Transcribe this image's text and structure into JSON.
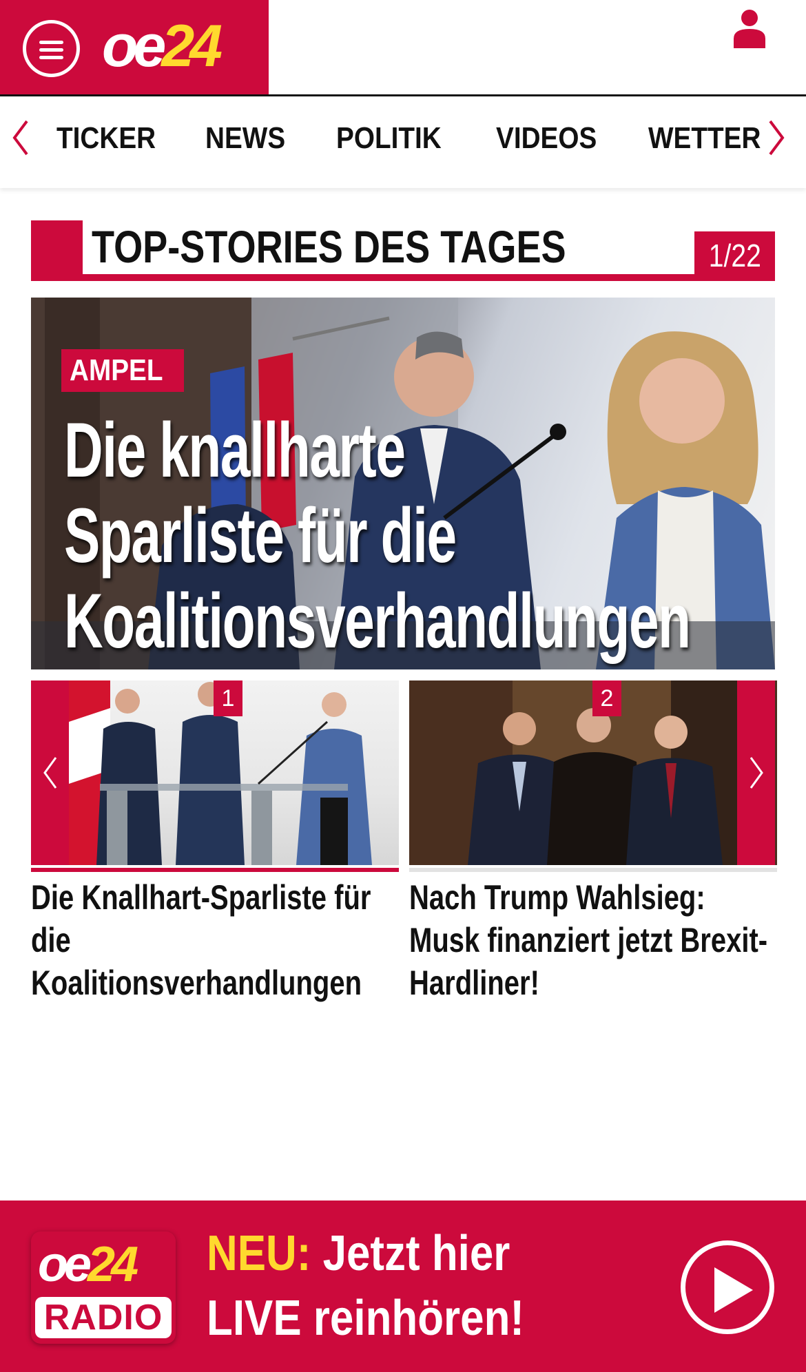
{
  "header": {
    "logo_oe": "oe",
    "logo_num": "24"
  },
  "nav": {
    "items": [
      {
        "label": "TICKER"
      },
      {
        "label": "NEWS"
      },
      {
        "label": "POLITIK"
      },
      {
        "label": "VIDEOS"
      },
      {
        "label": "WETTER"
      }
    ]
  },
  "section": {
    "title": "TOP-STORIES DES TAGES",
    "counter": "1/22"
  },
  "hero": {
    "tag": "AMPEL",
    "headline": "Die knallharte\nSparliste für die\nKoalitionsverhandlungen"
  },
  "stories": [
    {
      "badge": "1",
      "title": "Die Knallhart-Sparliste für die Koalitionsverhandlungen"
    },
    {
      "badge": "2",
      "title": "Nach Trump Wahlsieg: Musk finanziert jetzt Brexit-Hardliner!"
    }
  ],
  "radio": {
    "logo_oe": "oe",
    "logo_num": "24",
    "logo_radio": "RADIO",
    "neu": "NEU:",
    "line1_rest": " Jetzt hier",
    "line2": "LIVE reinhören!"
  },
  "colors": {
    "brand_red": "#cc0a3c",
    "brand_yellow": "#ffd92e"
  },
  "icons": {
    "menu": "hamburger-icon",
    "user": "user-icon",
    "nav_prev": "chevron-left-icon",
    "nav_next": "chevron-right-icon",
    "play": "play-icon"
  }
}
